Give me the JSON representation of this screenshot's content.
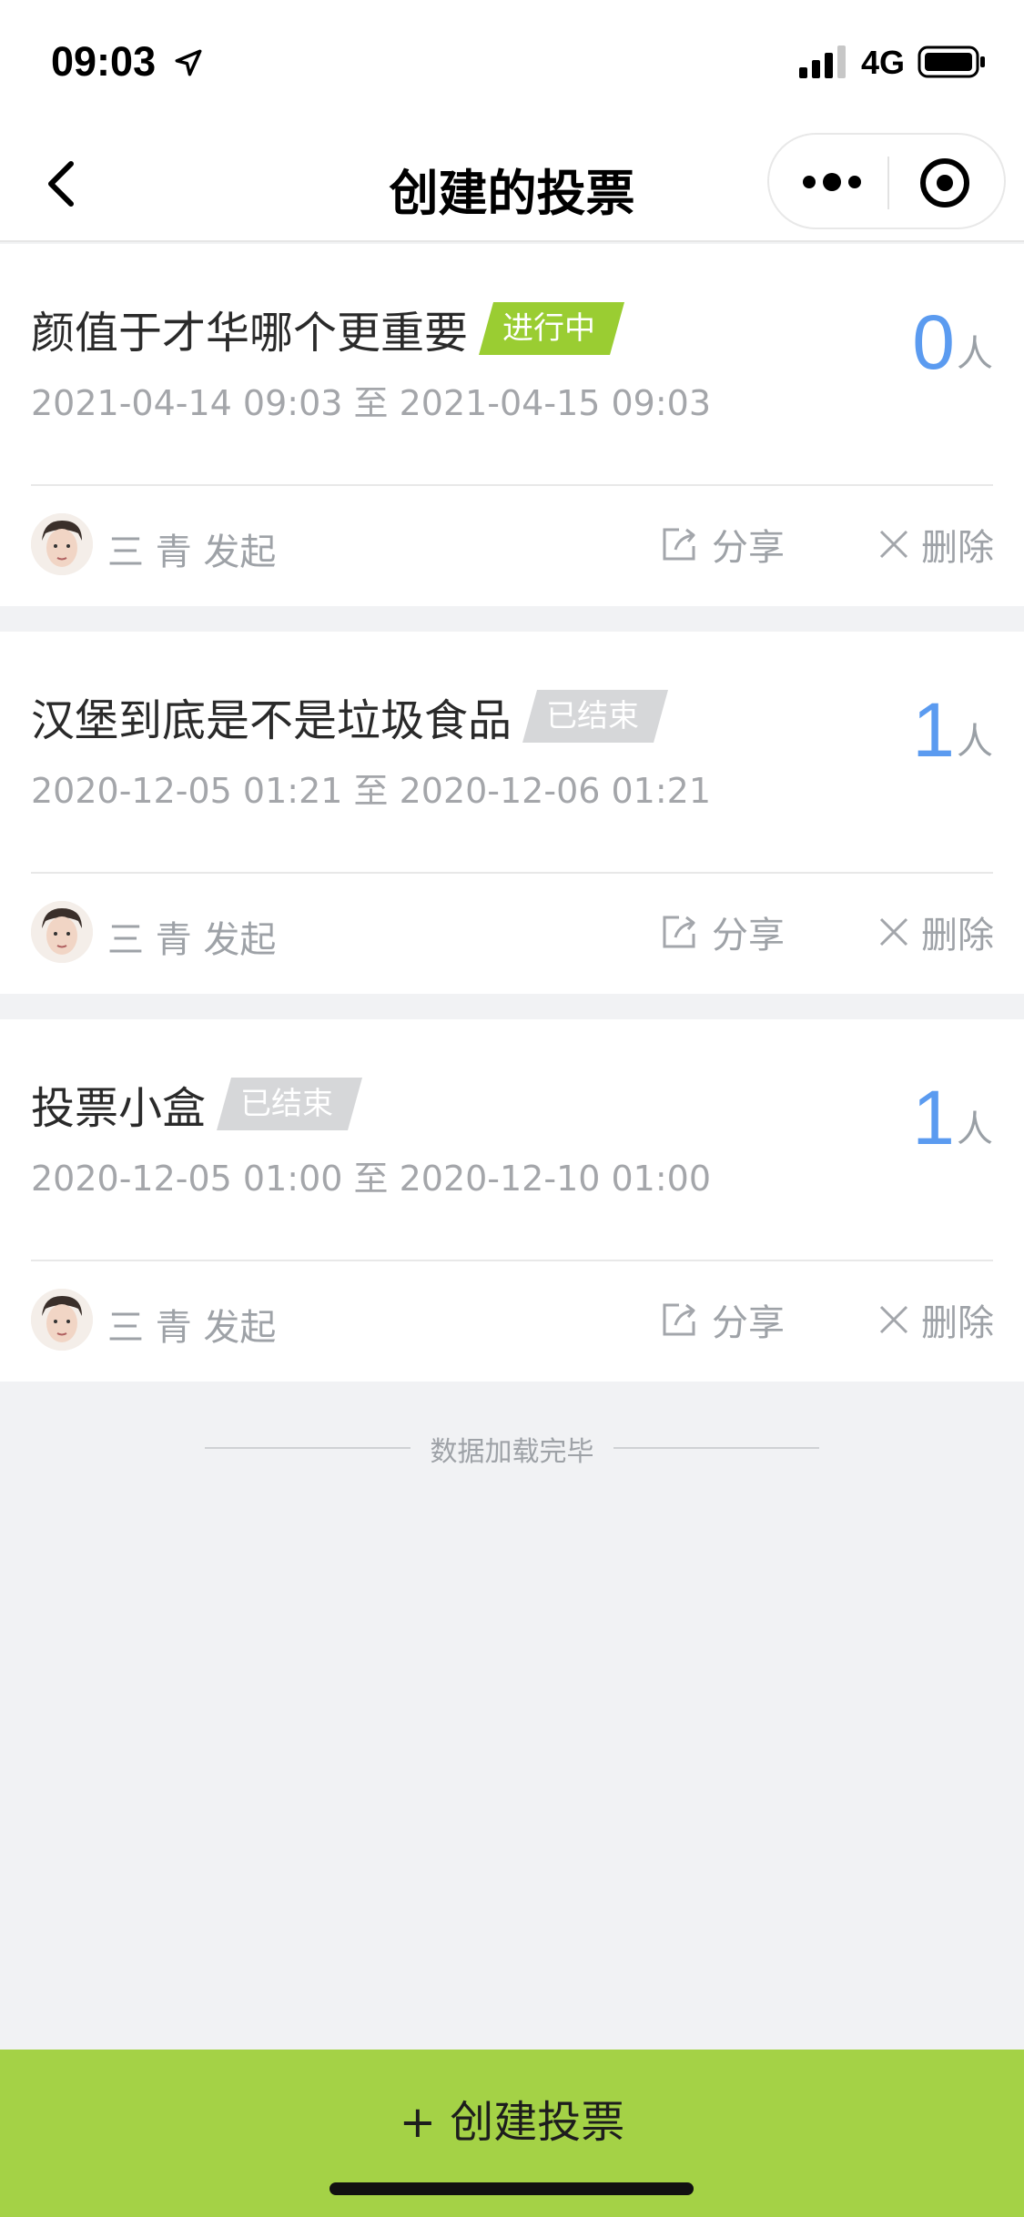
{
  "status_bar": {
    "time": "09:03",
    "network": "4G"
  },
  "nav": {
    "title": "创建的投票"
  },
  "votes": [
    {
      "title": "颜值于才华哪个更重要",
      "status": "进行中",
      "status_type": "active",
      "time_range": "2021-04-14 09:03 至 2021-04-15 09:03",
      "count": "0",
      "count_unit": "人",
      "initiator": "三 青 发起",
      "share_label": "分享",
      "delete_label": "删除"
    },
    {
      "title": "汉堡到底是不是垃圾食品",
      "status": "已结束",
      "status_type": "ended",
      "time_range": "2020-12-05 01:21 至 2020-12-06 01:21",
      "count": "1",
      "count_unit": "人",
      "initiator": "三 青 发起",
      "share_label": "分享",
      "delete_label": "删除"
    },
    {
      "title": "投票小盒",
      "status": "已结束",
      "status_type": "ended",
      "time_range": "2020-12-05 01:00 至 2020-12-10 01:00",
      "count": "1",
      "count_unit": "人",
      "initiator": "三 青 发起",
      "share_label": "分享",
      "delete_label": "删除"
    }
  ],
  "list_end_text": "数据加载完毕",
  "create_button_label": "+ 创建投票",
  "colors": {
    "accent_green": "#a4d246",
    "active_badge": "#9acd32",
    "ended_badge": "#d6d7d9",
    "count_blue": "#5b9bf0"
  },
  "icons": [
    "location-arrow-icon",
    "signal-icon",
    "battery-icon",
    "back-chevron-icon",
    "more-dots-icon",
    "target-circle-icon",
    "share-icon",
    "close-x-icon"
  ]
}
